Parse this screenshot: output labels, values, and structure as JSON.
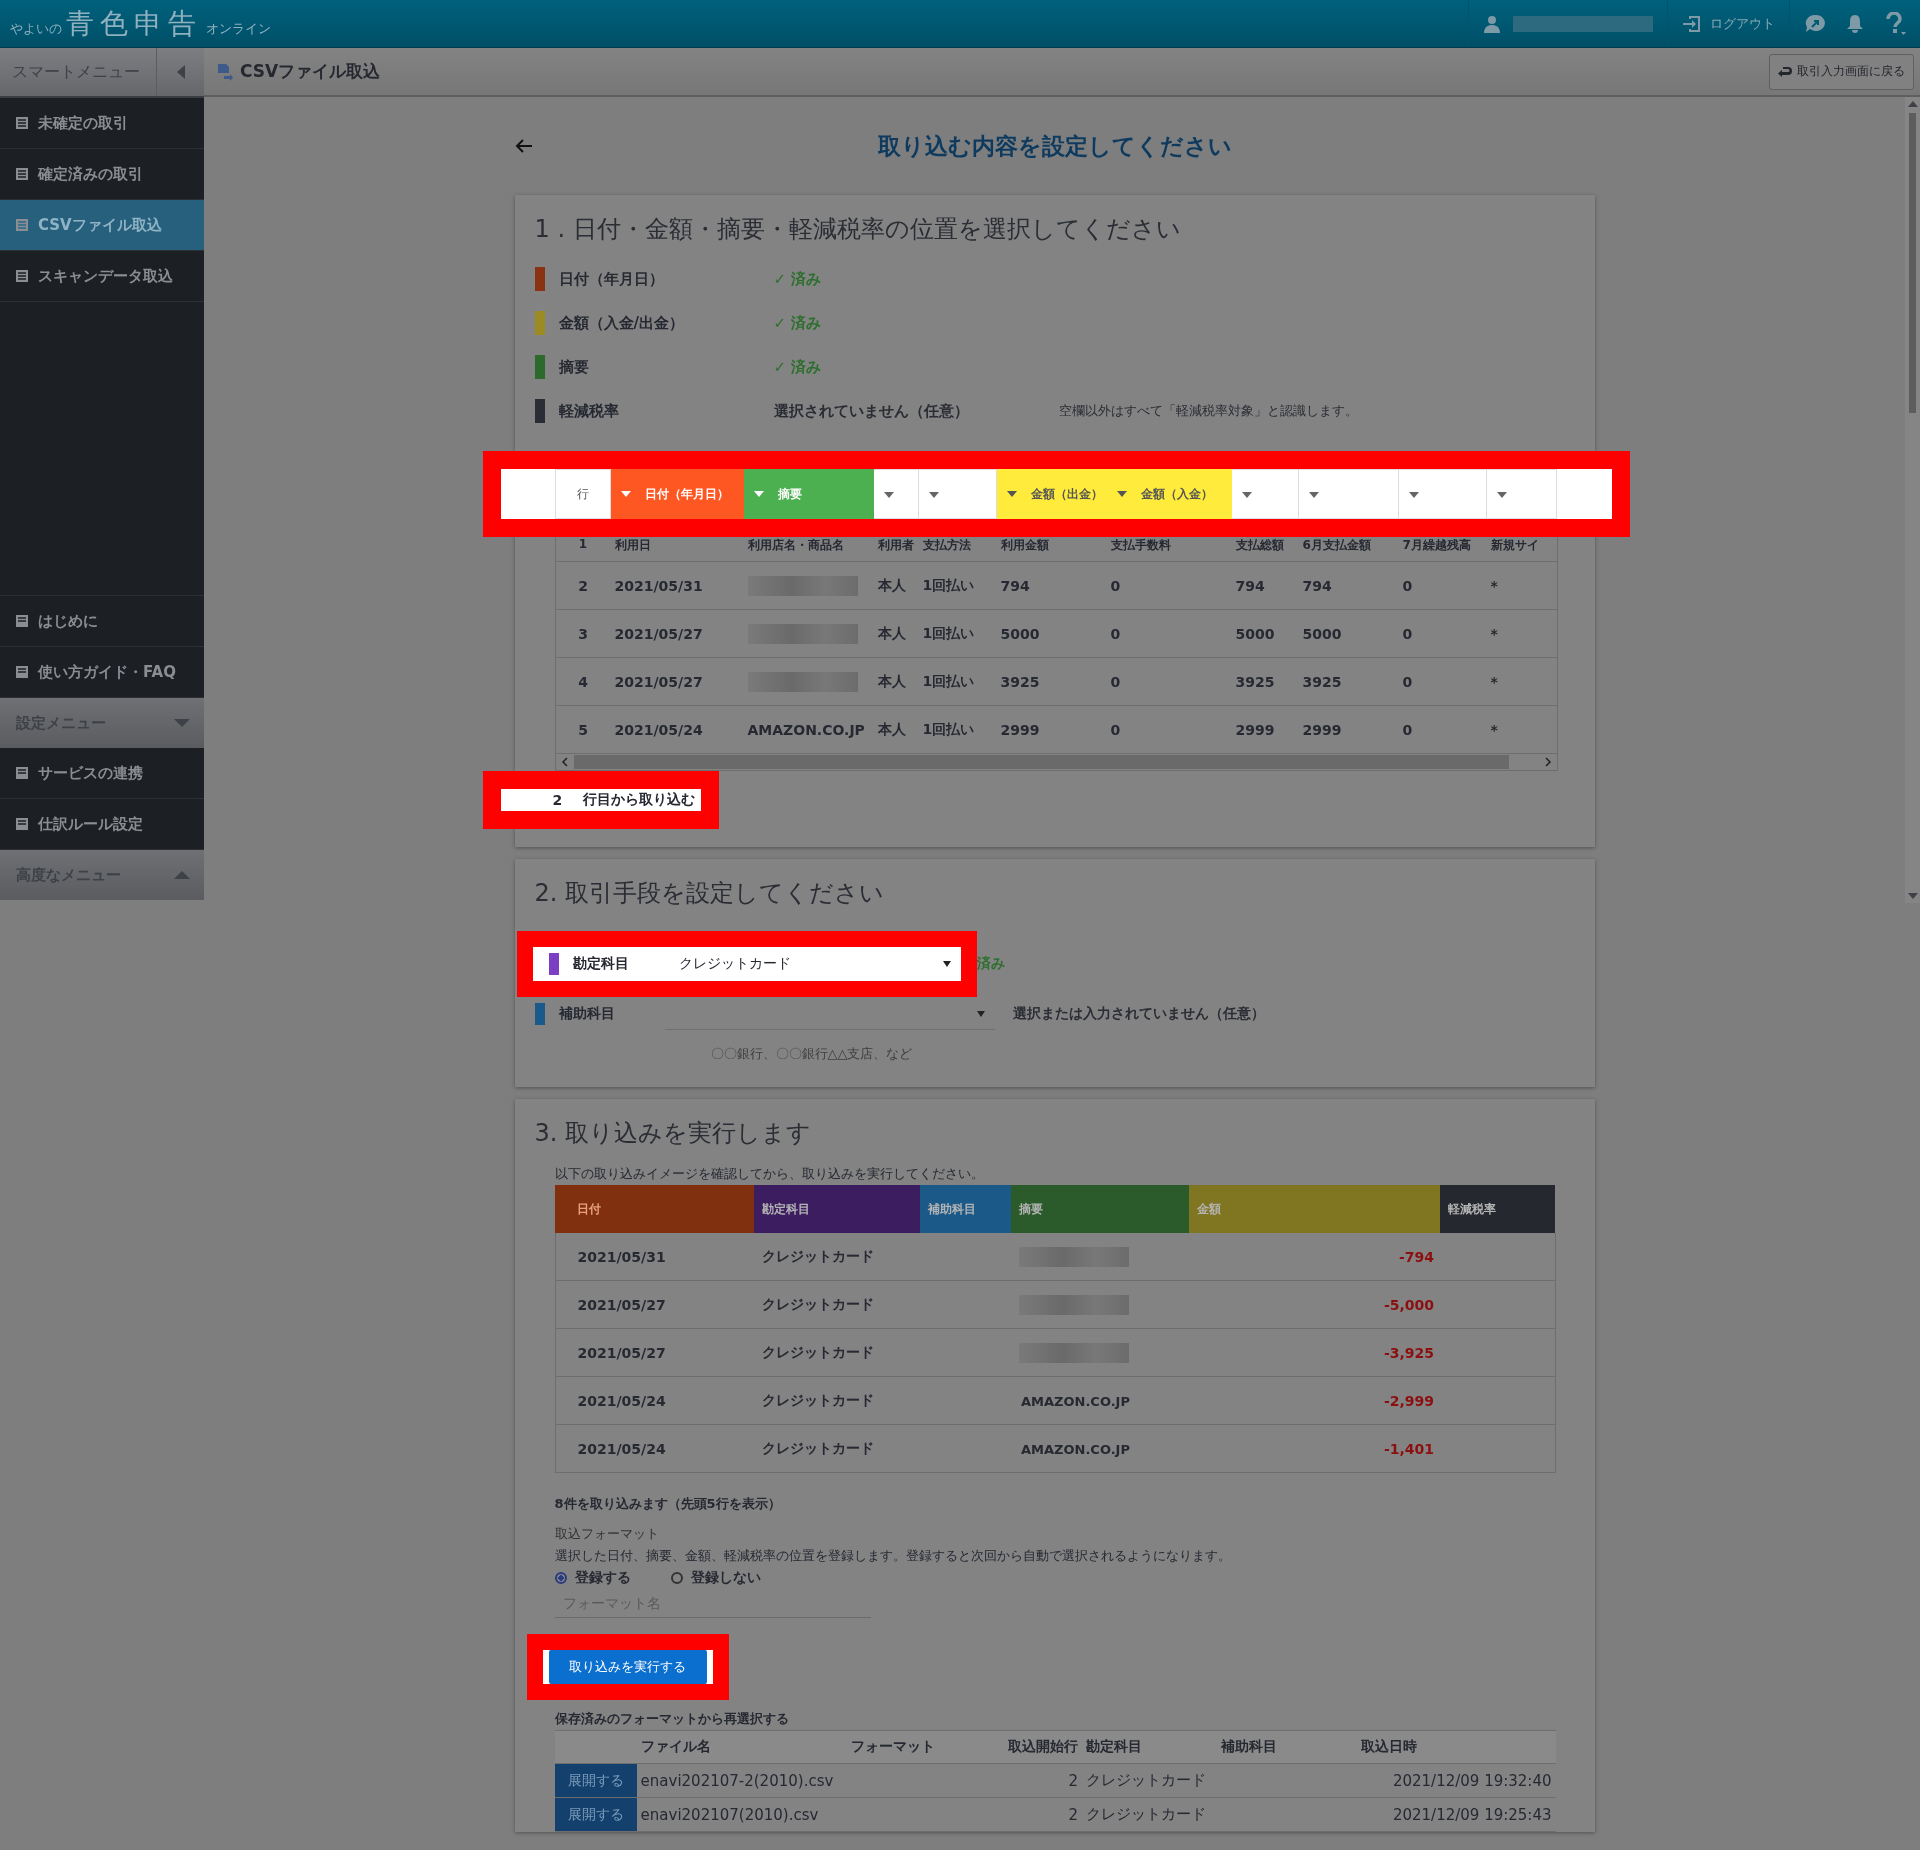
{
  "header": {
    "logo_small": "やよいの",
    "logo_main": "青色申告",
    "logo_suffix": "オンライン",
    "logout": "ログアウト"
  },
  "sidebar": {
    "title": "スマートメニュー",
    "top_items": [
      {
        "label": "未確定の取引",
        "selected": false
      },
      {
        "label": "確定済みの取引",
        "selected": false
      },
      {
        "label": "CSVファイル取込",
        "selected": true
      },
      {
        "label": "スキャンデータ取込",
        "selected": false
      }
    ],
    "bottom_items": [
      {
        "label": "はじめに",
        "kind": "item"
      },
      {
        "label": "使い方ガイド・FAQ",
        "kind": "item"
      },
      {
        "label": "設定メニュー",
        "kind": "group",
        "expanded": true
      },
      {
        "label": "サービスの連携",
        "kind": "item"
      },
      {
        "label": "仕訳ルール設定",
        "kind": "item"
      },
      {
        "label": "高度なメニュー",
        "kind": "group",
        "expanded": false
      }
    ]
  },
  "subheader": {
    "title": "CSVファイル取込",
    "back_button": "取引入力画面に戻る"
  },
  "heading": "取り込む内容を設定してください",
  "section1": {
    "title": "1 . 日付・金額・摘要・軽減税率の位置を選択してください",
    "legend": [
      {
        "label": "日付（年月日）",
        "color": "#8a3212",
        "status": "✓ 済み",
        "done": true
      },
      {
        "label": "金額（入金/出金）",
        "color": "#9c8b22",
        "status": "✓ 済み",
        "done": true
      },
      {
        "label": "摘要",
        "color": "#2b6a2b",
        "status": "✓ 済み",
        "done": true
      },
      {
        "label": "軽減税率",
        "color": "#2a2d36",
        "status": "選択されていません（任意）",
        "done": false,
        "note": "空欄以外はすべて「軽減税率対象」と認識します。"
      }
    ],
    "mapping": {
      "highlighted": true,
      "columns": [
        {
          "label": "行",
          "kind": "row"
        },
        {
          "label": "日付（年月日）",
          "kind": "date"
        },
        {
          "label": "摘要",
          "kind": "summary"
        },
        {
          "kind": "none"
        },
        {
          "kind": "none"
        },
        {
          "label": "金額（出金）",
          "kind": "amount"
        },
        {
          "label": "金額（入金）",
          "kind": "amount"
        },
        {
          "kind": "none"
        },
        {
          "kind": "none"
        },
        {
          "kind": "none"
        },
        {
          "kind": "none"
        }
      ]
    },
    "rows": [
      {
        "cells": [
          "1",
          "利用日",
          "利用店名・商品名",
          "利用者",
          "支払方法",
          "利用金額",
          "支払手数料",
          "支払総額",
          "6月支払金額",
          "7月繰越残高",
          "新規サイ"
        ]
      },
      {
        "cells": [
          "2",
          "2021/05/31",
          {
            "redacted": true
          },
          "本人",
          "1回払い",
          "794",
          "0",
          "794",
          "794",
          "0",
          "*"
        ]
      },
      {
        "cells": [
          "3",
          "2021/05/27",
          {
            "redacted": true
          },
          "本人",
          "1回払い",
          "5000",
          "0",
          "5000",
          "5000",
          "0",
          "*"
        ]
      },
      {
        "cells": [
          "4",
          "2021/05/27",
          {
            "redacted": true
          },
          "本人",
          "1回払い",
          "3925",
          "0",
          "3925",
          "3925",
          "0",
          "*"
        ]
      },
      {
        "cells": [
          "5",
          "2021/05/24",
          "AMAZON.CO.JP",
          "本人",
          "1回払い",
          "2999",
          "0",
          "2999",
          "2999",
          "0",
          "*"
        ]
      }
    ],
    "start_row": {
      "value": "2",
      "label": "行目から取り込む",
      "highlighted": true
    }
  },
  "section2": {
    "title": "2. 取引手段を設定してください",
    "fields": [
      {
        "label": "勘定科目",
        "color": "#7b3fc4",
        "value": "クレジットカード",
        "status": "済み",
        "done": true,
        "highlighted": true
      },
      {
        "label": "補助科目",
        "color": "#1a5a8a",
        "status": "選択または入力されていません（任意）",
        "done": false,
        "highlighted": false,
        "hint": "〇〇銀行、〇〇銀行△△支店、など"
      }
    ]
  },
  "section3": {
    "title": "3. 取り込みを実行します",
    "intro": "以下の取り込みイメージを確認してから、取り込みを実行してください。",
    "preview_columns": [
      {
        "label": "日付",
        "color": "#80300f"
      },
      {
        "label": "勘定科目",
        "color": "#3c1e60"
      },
      {
        "label": "補助科目",
        "color": "#1b5a88"
      },
      {
        "label": "摘要",
        "color": "#2b5a2b"
      },
      {
        "label": "金額",
        "color": "#807520"
      },
      {
        "label": "軽減税率",
        "color": "#25282f"
      }
    ],
    "preview_rows": [
      {
        "date": "2021/05/31",
        "account": "クレジットカード",
        "redacted": true,
        "amount": "-794"
      },
      {
        "date": "2021/05/27",
        "account": "クレジットカード",
        "redacted": true,
        "amount": "-5,000"
      },
      {
        "date": "2021/05/27",
        "account": "クレジットカード",
        "redacted": true,
        "amount": "-3,925"
      },
      {
        "date": "2021/05/24",
        "account": "クレジットカード",
        "summary": "AMAZON.CO.JP",
        "redacted": false,
        "amount": "-2,999"
      },
      {
        "date": "2021/05/24",
        "account": "クレジットカード",
        "summary": "AMAZON.CO.JP",
        "redacted": false,
        "amount": "-1,401"
      }
    ],
    "count": "8件を取り込みます（先頭5行を表示）",
    "format_label": "取込フォーマット",
    "format_desc": "選択した日付、摘要、金額、軽減税率の位置を登録します。登録すると次回から自動で選択されるようになります。",
    "radios": [
      {
        "label": "登録する",
        "selected": true
      },
      {
        "label": "登録しない",
        "selected": false
      }
    ],
    "format_name": {
      "placeholder": "フォーマット名"
    },
    "execute": {
      "label": "取り込みを実行する",
      "highlighted": true
    },
    "saved_title": "保存済みのフォーマットから再選択する",
    "saved_columns": [
      "ファイル名",
      "フォーマット",
      "取込開始行",
      "勘定科目",
      "補助科目",
      "取込日時"
    ],
    "saved_rows": [
      {
        "button": "展開する",
        "file": "enavi202107-2(2010).csv",
        "start": "2",
        "account": "クレジットカード",
        "date": "2021/12/09 19:32:40"
      },
      {
        "button": "展開する",
        "file": "enavi202107(2010).csv",
        "start": "2",
        "account": "クレジットカード",
        "date": "2021/12/09 19:25:43"
      }
    ]
  }
}
